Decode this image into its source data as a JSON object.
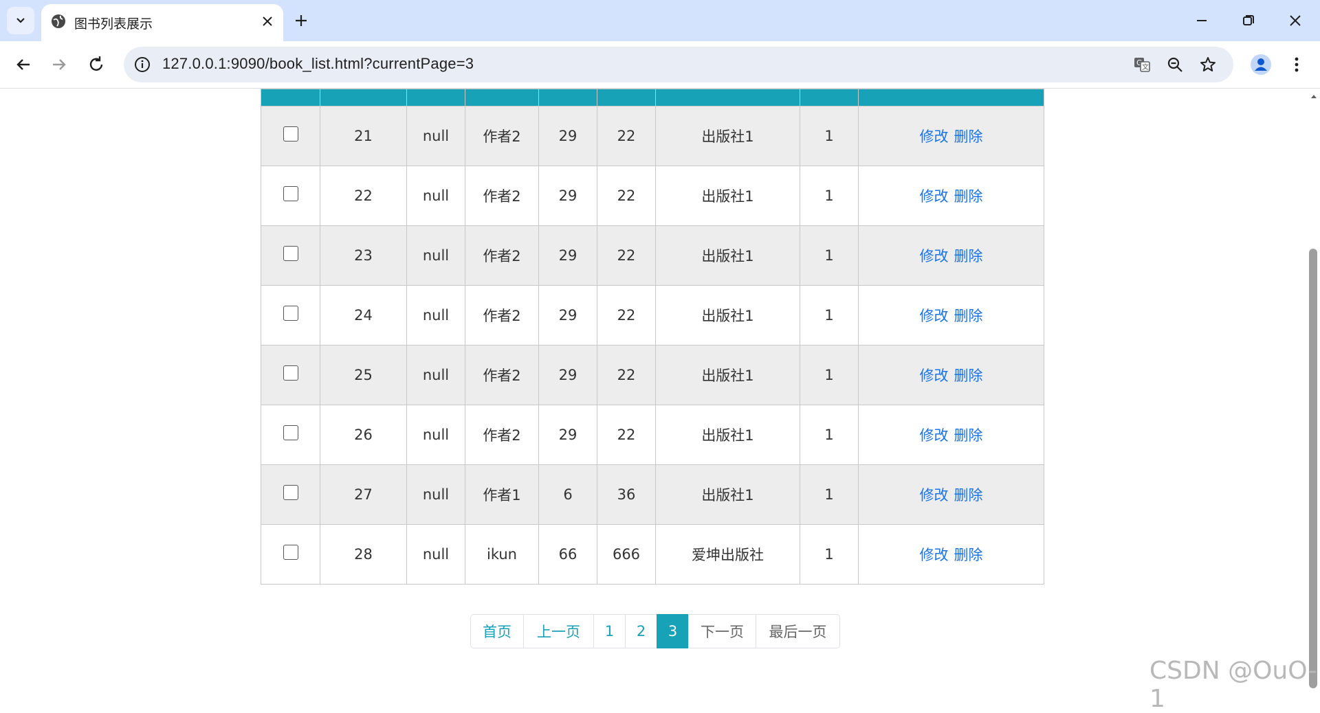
{
  "browser": {
    "tab_title": "图书列表展示",
    "url": "127.0.0.1:9090/book_list.html?currentPage=3"
  },
  "table": {
    "rows": [
      {
        "id": "21",
        "name": "null",
        "author": "作者2",
        "count": "29",
        "price": "22",
        "publisher": "出版社1",
        "status": "1",
        "edit": "修改",
        "delete": "删除"
      },
      {
        "id": "22",
        "name": "null",
        "author": "作者2",
        "count": "29",
        "price": "22",
        "publisher": "出版社1",
        "status": "1",
        "edit": "修改",
        "delete": "删除"
      },
      {
        "id": "23",
        "name": "null",
        "author": "作者2",
        "count": "29",
        "price": "22",
        "publisher": "出版社1",
        "status": "1",
        "edit": "修改",
        "delete": "删除"
      },
      {
        "id": "24",
        "name": "null",
        "author": "作者2",
        "count": "29",
        "price": "22",
        "publisher": "出版社1",
        "status": "1",
        "edit": "修改",
        "delete": "删除"
      },
      {
        "id": "25",
        "name": "null",
        "author": "作者2",
        "count": "29",
        "price": "22",
        "publisher": "出版社1",
        "status": "1",
        "edit": "修改",
        "delete": "删除"
      },
      {
        "id": "26",
        "name": "null",
        "author": "作者2",
        "count": "29",
        "price": "22",
        "publisher": "出版社1",
        "status": "1",
        "edit": "修改",
        "delete": "删除"
      },
      {
        "id": "27",
        "name": "null",
        "author": "作者1",
        "count": "6",
        "price": "36",
        "publisher": "出版社1",
        "status": "1",
        "edit": "修改",
        "delete": "删除"
      },
      {
        "id": "28",
        "name": "null",
        "author": "ikun",
        "count": "66",
        "price": "666",
        "publisher": "爱坤出版社",
        "status": "1",
        "edit": "修改",
        "delete": "删除"
      }
    ]
  },
  "pagination": {
    "first": "首页",
    "prev": "上一页",
    "pages": [
      "1",
      "2",
      "3"
    ],
    "active_page": "3",
    "next": "下一页",
    "last": "最后一页"
  },
  "watermark": "CSDN @OuO-1",
  "colors": {
    "accent": "#17a2b8",
    "link": "#1a73e8",
    "row_alt": "#ededed",
    "tabstrip": "#d3e3fd"
  }
}
